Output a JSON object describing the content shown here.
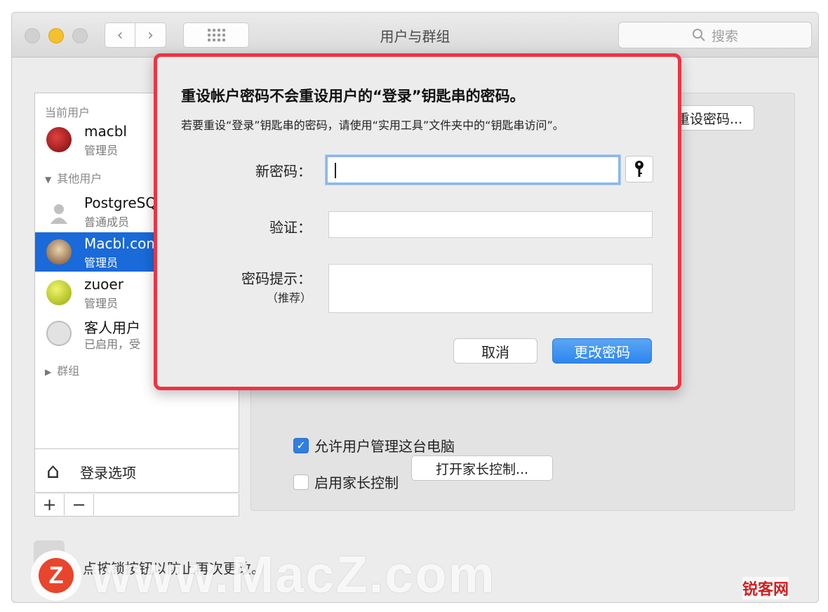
{
  "window": {
    "title": "用户与群组"
  },
  "search": {
    "placeholder": "搜索"
  },
  "sidebar": {
    "current_section": "当前用户",
    "other_section": "其他用户",
    "groups_section": "群组",
    "users": [
      {
        "name": "macbl",
        "role": "管理员",
        "avatar_color": "#b01d1d"
      },
      {
        "name": "PostgreSQ",
        "role": "普通成员",
        "avatar_color": "#c8c8c8"
      },
      {
        "name": "Macbl.com",
        "role": "管理员",
        "avatar_color": "#8b5a3c"
      },
      {
        "name": "zuoer",
        "role": "管理员",
        "avatar_color": "#c7d81a"
      },
      {
        "name": "客人用户",
        "role": "已启用，受",
        "avatar_color": "#d6d6d6"
      }
    ],
    "login_options": "登录选项",
    "add_label": "+",
    "remove_label": "−"
  },
  "panel": {
    "reset_password_label": "重设密码...",
    "allow_admin_label": "允许用户管理这台电脑",
    "allow_admin_checked": true,
    "parental_label": "启用家长控制",
    "parental_checked": false,
    "open_parental_label": "打开家长控制..."
  },
  "lock": {
    "text": "点按锁按钮以防止再次更改。"
  },
  "watermark": {
    "text": "www.MacZ.com",
    "logo_letter": "Z",
    "corner_brand": "锐客网"
  },
  "dialog": {
    "title": "重设帐户密码不会重设用户的“登录”钥匙串的密码。",
    "subtitle": "若要重设“登录”钥匙串的密码，请使用“实用工具”文件夹中的“钥匙串访问”。",
    "new_password_label": "新密码：",
    "verify_label": "验证：",
    "hint_label": "密码提示：",
    "hint_sub_label": "（推荐）",
    "cancel_label": "取消",
    "change_label": "更改密码",
    "accent_color": "#ee3344"
  }
}
